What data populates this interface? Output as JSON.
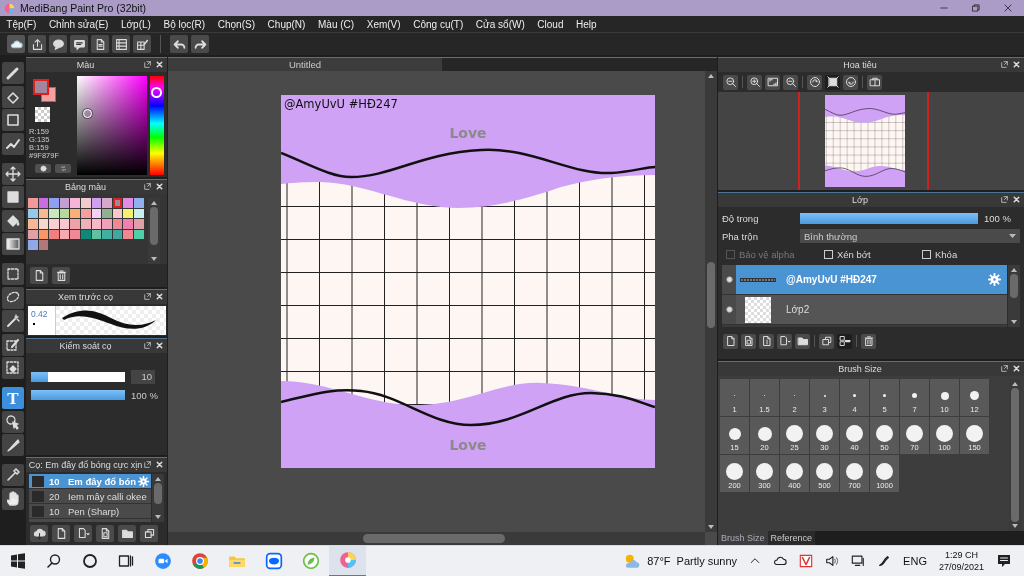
{
  "window": {
    "title": "MediBang Paint Pro (32bit)"
  },
  "menu": [
    "Tệp(F)",
    "Chỉnh sửa(E)",
    "Lớp(L)",
    "Bộ lọc(R)",
    "Chọn(S)",
    "Chụp(N)",
    "Màu (C)",
    "Xem(V)",
    "Công cụ(T)",
    "Cửa sổ(W)",
    "Cloud",
    "Help"
  ],
  "tools": [
    {
      "kind": "brush",
      "selected": false
    },
    {
      "kind": "eraser",
      "selected": false
    },
    {
      "kind": "dot",
      "selected": false
    },
    {
      "kind": "graph",
      "selected": false
    },
    {
      "kind": "move",
      "selected": false
    },
    {
      "kind": "fill",
      "selected": false
    },
    {
      "kind": "bucket",
      "selected": false
    },
    {
      "kind": "gradient",
      "selected": false
    },
    {
      "kind": "select",
      "selected": false
    },
    {
      "kind": "lasso",
      "selected": false
    },
    {
      "kind": "wand",
      "selected": false
    },
    {
      "kind": "selpen",
      "selected": false
    },
    {
      "kind": "seleraser",
      "selected": false
    },
    {
      "kind": "text",
      "glyph": "T",
      "selected": true
    },
    {
      "kind": "operation",
      "selected": false
    },
    {
      "kind": "knife",
      "selected": false
    },
    {
      "kind": "dropper",
      "selected": false
    },
    {
      "kind": "hand",
      "selected": false
    }
  ],
  "color_panel": {
    "title": "Màu",
    "r": "R:159",
    "g": "G:135",
    "b": "B:159",
    "hex": "#9F879F"
  },
  "palette": {
    "title": "Bảng màu",
    "swatches": [
      {
        "color": "#f29a9a",
        "selected": false
      },
      {
        "color": "#c86ee0",
        "selected": false
      },
      {
        "color": "#8fa0f0",
        "selected": false
      },
      {
        "color": "#c4a0d0",
        "selected": false
      },
      {
        "color": "#f6b4d8",
        "selected": false
      },
      {
        "color": "#f2cccc",
        "selected": false
      },
      {
        "color": "#d0a0f0",
        "selected": false
      },
      {
        "color": "#d8a8c8",
        "selected": false
      },
      {
        "color": "#9f879f",
        "selected": true
      },
      {
        "color": "#e08ce0",
        "selected": false
      },
      {
        "color": "#90b0f0",
        "selected": false
      },
      {
        "color": "#98c8e8",
        "selected": false
      },
      {
        "color": "#f8b890",
        "selected": false
      },
      {
        "color": "#c8e8c0",
        "selected": false
      },
      {
        "color": "#b8d8a0",
        "selected": false
      },
      {
        "color": "#f8b078",
        "selected": false
      },
      {
        "color": "#f4a0a0",
        "selected": false
      },
      {
        "color": "#f4d0f8",
        "selected": false
      },
      {
        "color": "#90b090",
        "selected": false
      },
      {
        "color": "#f8c8c8",
        "selected": false
      },
      {
        "color": "#f8f070",
        "selected": false
      },
      {
        "color": "#c8f0f0",
        "selected": false
      },
      {
        "color": "#f8b898",
        "selected": false
      },
      {
        "color": "#f8d8c8",
        "selected": false
      },
      {
        "color": "#f8d0d0",
        "selected": false
      },
      {
        "color": "#f8c8d0",
        "selected": false
      },
      {
        "color": "#f0a0a8",
        "selected": false
      },
      {
        "color": "#f0b0b8",
        "selected": false
      },
      {
        "color": "#f8b8c8",
        "selected": false
      },
      {
        "color": "#f0a0b8",
        "selected": false
      },
      {
        "color": "#f08898",
        "selected": false
      },
      {
        "color": "#f080b0",
        "selected": false
      },
      {
        "color": "#e0a0a8",
        "selected": false
      },
      {
        "color": "#e0a0a8",
        "selected": false
      },
      {
        "color": "#f89868",
        "selected": false
      },
      {
        "color": "#f08080",
        "selected": false
      },
      {
        "color": "#f8a8b0",
        "selected": false
      },
      {
        "color": "#f08898",
        "selected": false
      },
      {
        "color": "#108878",
        "selected": false
      },
      {
        "color": "#60c0a0",
        "selected": false
      },
      {
        "color": "#40b0a0",
        "selected": false
      },
      {
        "color": "#40a8a0",
        "selected": false
      },
      {
        "color": "#f08890",
        "selected": false
      },
      {
        "color": "#50d0a8",
        "selected": false
      },
      {
        "color": "#90a8e8",
        "selected": false
      },
      {
        "color": "#b07878",
        "selected": false
      }
    ]
  },
  "brush_preview": {
    "title": "Xem trước cọ",
    "size": "0.42"
  },
  "brush_control": {
    "title": "Kiểm soát cọ",
    "sliders": [
      {
        "level": 0.18,
        "reading": "10"
      },
      {
        "level": 1,
        "reading": "100 %"
      }
    ]
  },
  "brushes": {
    "title": "Cọ: Em đây đổ bóng cực xịn",
    "items": [
      {
        "size": "10",
        "name": "Em đây đổ bón",
        "selected": true
      },
      {
        "size": "20",
        "name": "Iem mây calli okee",
        "selected": false
      },
      {
        "size": "10",
        "name": "Pen (Sharp)",
        "selected": false
      }
    ]
  },
  "canvas": {
    "tab": "Untitled",
    "signature": "@AmyUvU #HĐ247",
    "labels": [
      "Love",
      "Love"
    ]
  },
  "navigator": {
    "title": "Hoa tiêu"
  },
  "layers": {
    "title": "Lớp",
    "opacity_label": "Độ trong",
    "opacity": {
      "level": 1,
      "reading": "100 %"
    },
    "blend_label": "Pha trộn",
    "blend_value": "Bình thường",
    "options": [
      {
        "label": "Bảo vệ alpha",
        "checked": false,
        "disabled": true
      },
      {
        "label": "Xén bớt",
        "checked": false,
        "disabled": false
      },
      {
        "label": "Khóa",
        "checked": false,
        "disabled": false
      }
    ],
    "items": [
      {
        "name": "@AmyUvU #HĐ247",
        "kind": "text",
        "selected": true
      },
      {
        "name": "Lớp2",
        "kind": "raster",
        "selected": false
      }
    ]
  },
  "brush_size": {
    "title": "Brush Size",
    "sizes": [
      "1",
      "1.5",
      "2",
      "3",
      "4",
      "5",
      "7",
      "10",
      "12",
      "15",
      "20",
      "25",
      "30",
      "40",
      "50",
      "70",
      "100",
      "150",
      "200",
      "300",
      "400",
      "500",
      "700",
      "1000"
    ],
    "tabs": [
      {
        "label": "Brush Size",
        "selected": true
      },
      {
        "label": "Reference",
        "selected": false
      }
    ]
  },
  "taskbar": {
    "apps": [
      {
        "kind": "zoom",
        "active": false
      },
      {
        "kind": "chrome",
        "active": false
      },
      {
        "kind": "explorer",
        "active": false
      },
      {
        "kind": "zalo",
        "active": false
      },
      {
        "kind": "leaf",
        "active": false
      },
      {
        "kind": "medibang",
        "active": true
      }
    ],
    "weather_temp": "87°F",
    "weather_text": "Partly sunny",
    "language": "ENG",
    "time": "1:29 CH",
    "date": "27/09/2021"
  }
}
